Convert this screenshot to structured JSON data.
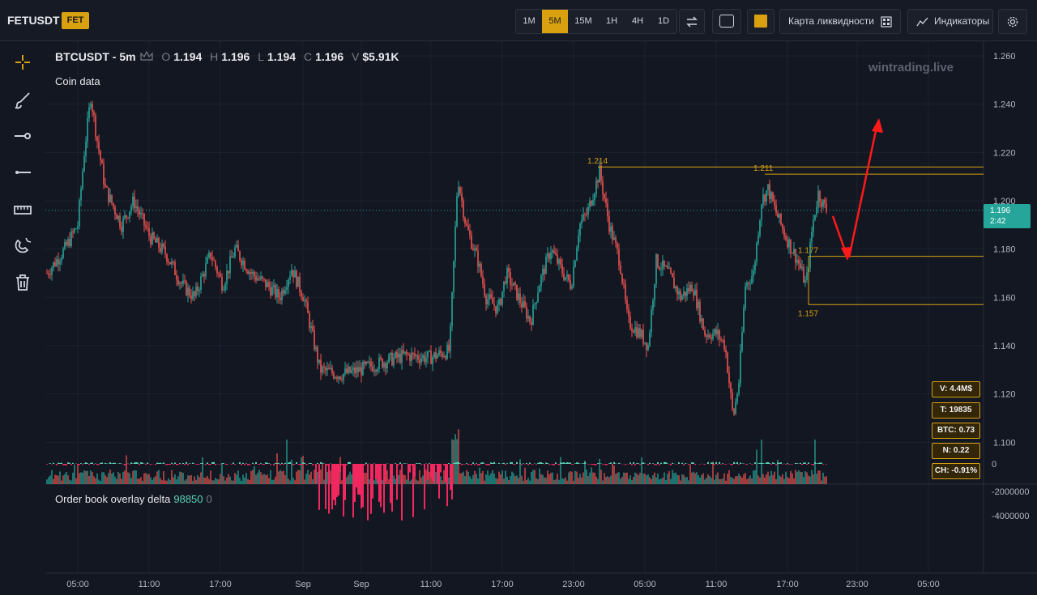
{
  "header": {
    "symbol": "FETUSDT",
    "badge": "FET",
    "timeframes": [
      "1M",
      "5M",
      "15M",
      "1H",
      "4H",
      "1D"
    ],
    "active_tf": "5M",
    "liquidity_map": "Карта ликвидности",
    "indicators": "Индикаторы"
  },
  "legend": {
    "title": "BTCUSDT - 5m",
    "o_label": "O",
    "o": "1.194",
    "h_label": "H",
    "h": "1.196",
    "l_label": "L",
    "l": "1.194",
    "c_label": "C",
    "c": "1.196",
    "v_label": "V",
    "v": "$5.91K"
  },
  "indicator_label": "Coin data",
  "watermark": "wintrading.live",
  "price_axis": [
    "1.260",
    "1.240",
    "1.220",
    "1.200",
    "1.180",
    "1.160",
    "1.140",
    "1.120",
    "1.100"
  ],
  "current_price": {
    "value": "1.196",
    "timer": "2:42"
  },
  "levels": [
    {
      "label": "1.214",
      "price": 1.214
    },
    {
      "label": "1.211",
      "price": 1.211
    },
    {
      "label": "1.177",
      "price": 1.177
    },
    {
      "label": "1.157",
      "price": 1.157
    }
  ],
  "stats": [
    "V: 4.4M$",
    "T: 19835",
    "BTC: 0.73",
    "N: 0.22",
    "CH: -0.91%"
  ],
  "orderbook": {
    "title": "Order book overlay delta",
    "value": "98850",
    "zero": "0",
    "axis": [
      "0",
      "-2000000",
      "-4000000"
    ]
  },
  "time_axis": [
    "05:00",
    "11:00",
    "17:00",
    "Sep",
    "Sep",
    "11:00",
    "17:00",
    "23:00",
    "05:00",
    "11:00",
    "17:00",
    "23:00",
    "05:00"
  ],
  "colors": {
    "bg": "#131722",
    "up": "#26a69a",
    "down": "#ef5350",
    "accent": "#d9a110",
    "delta_neg": "#f0285f",
    "delta_pos": "#5ad1b5",
    "arrow": "#ff1a1a"
  }
}
